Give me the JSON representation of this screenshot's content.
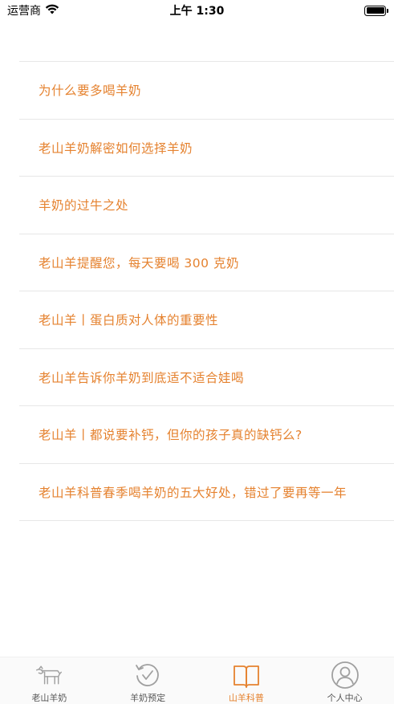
{
  "status_bar": {
    "carrier": "运营商",
    "time": "上午 1:30"
  },
  "articles": [
    {
      "title": "为什么要多喝羊奶"
    },
    {
      "title": "老山羊奶解密如何选择羊奶"
    },
    {
      "title": "羊奶的过牛之处"
    },
    {
      "title": "老山羊提醒您，每天要喝 300 克奶"
    },
    {
      "title": "老山羊丨蛋白质对人体的重要性"
    },
    {
      "title": "老山羊告诉你羊奶到底适不适合娃喝"
    },
    {
      "title": "老山羊丨都说要补钙，但你的孩子真的缺钙么?"
    },
    {
      "title": "老山羊科普春季喝羊奶的五大好处，错过了要再等一年"
    }
  ],
  "tab_bar": {
    "tabs": [
      {
        "label": "老山羊奶",
        "icon": "goat-icon",
        "active": false
      },
      {
        "label": "羊奶预定",
        "icon": "reorder-check-icon",
        "active": false
      },
      {
        "label": "山羊科普",
        "icon": "book-icon",
        "active": true
      },
      {
        "label": "个人中心",
        "icon": "user-profile-icon",
        "active": false
      }
    ]
  },
  "colors": {
    "accent": "#e5822f",
    "inactive_icon": "#a0a0a0",
    "divider": "#e7e7e7"
  }
}
